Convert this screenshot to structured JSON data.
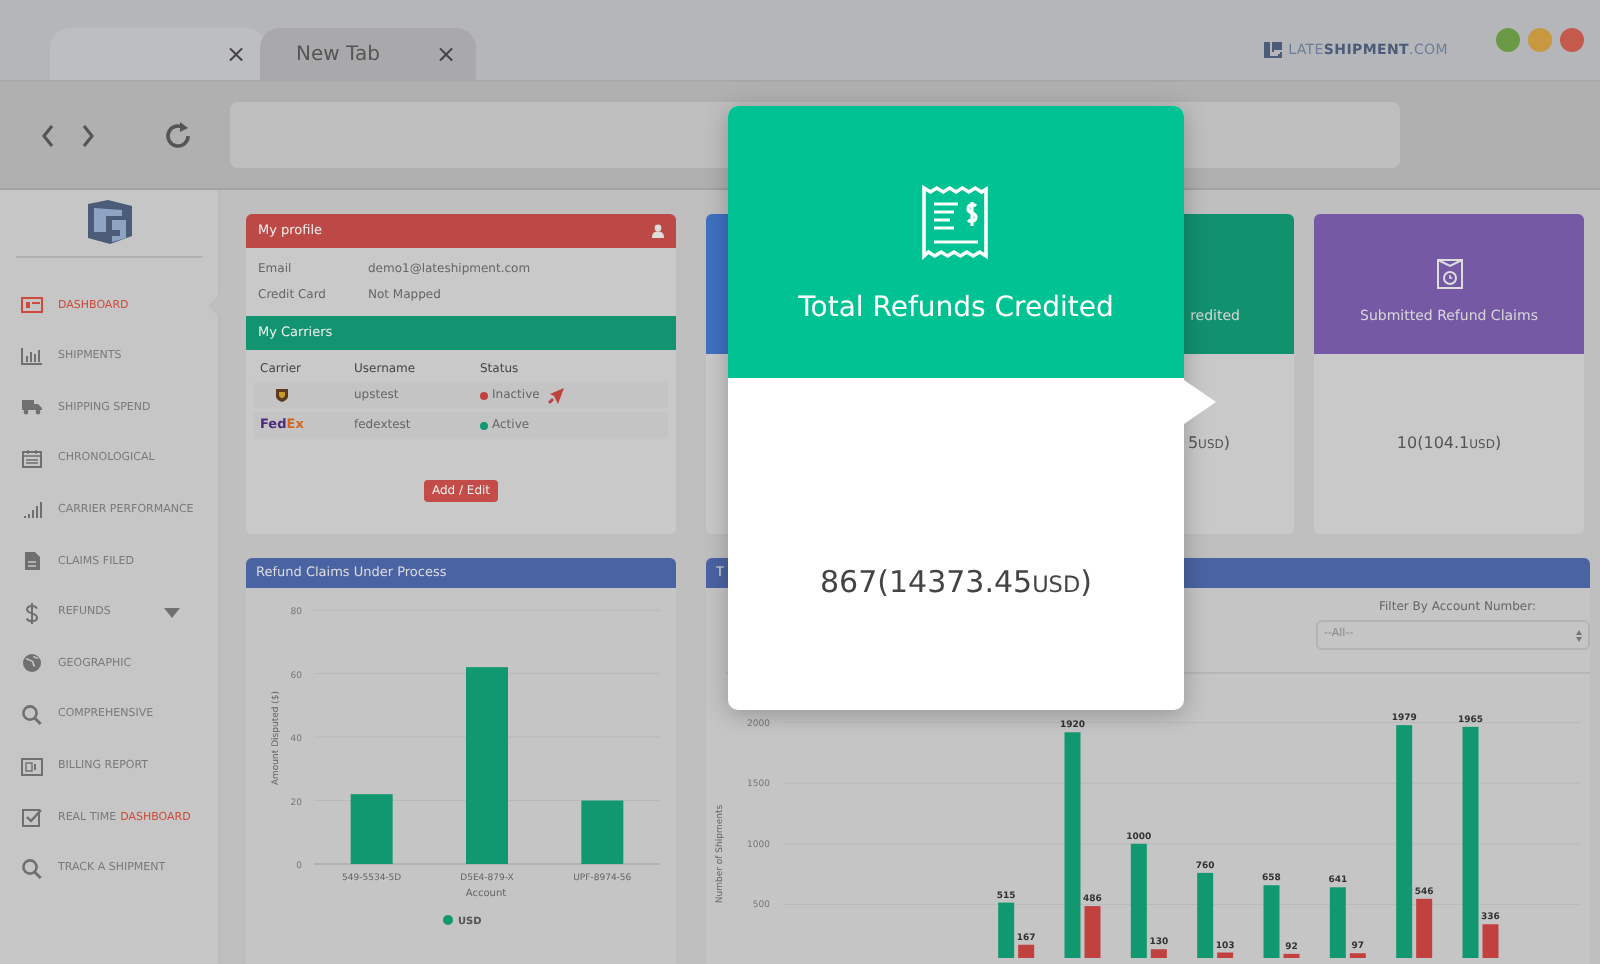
{
  "browser": {
    "tabs": [
      {
        "close": "×",
        "selected": true
      },
      {
        "label": "New Tab",
        "close": "×",
        "selected": false
      }
    ],
    "logo": {
      "parts": [
        "LATE",
        "SHIPMENT",
        ".COM"
      ]
    },
    "window_dots": [
      {
        "color": "#6a9a45"
      },
      {
        "color": "#c7983f"
      },
      {
        "color": "#c35a4c"
      }
    ]
  },
  "sidebar": {
    "items": [
      {
        "label": "DASHBOARD",
        "selected": true
      },
      {
        "label": "SHIPMENTS",
        "selected": false
      },
      {
        "label": "SHIPPING SPEND",
        "selected": false
      },
      {
        "label": "CHRONOLOGICAL",
        "selected": false
      },
      {
        "label": "CARRIER PERFORMANCE",
        "selected": false
      },
      {
        "label": "CLAIMS FILED",
        "selected": false
      },
      {
        "label": "REFUNDS",
        "selected": false,
        "dropdown": true
      },
      {
        "label": "GEOGRAPHIC",
        "selected": false
      },
      {
        "label": "COMPREHENSIVE",
        "selected": false
      },
      {
        "label": "BILLING REPORT",
        "selected": false
      },
      {
        "label": "REAL TIME",
        "accent": "DASHBOARD",
        "selected": false
      },
      {
        "label": "TRACK A SHIPMENT",
        "selected": false
      }
    ]
  },
  "profile": {
    "title": "My profile",
    "fields": [
      {
        "label": "Email",
        "value": "demo1@lateshipment.com"
      },
      {
        "label": "Credit Card",
        "value": "Not Mapped"
      }
    ]
  },
  "carriers": {
    "title": "My Carriers",
    "columns": [
      "Carrier",
      "Username",
      "Status"
    ],
    "rows": [
      {
        "kind": "ups",
        "username": "upstest",
        "status": "Inactive",
        "color": "#c0413e",
        "alert": true
      },
      {
        "kind": "fedex",
        "logo_parts": [
          "Fed",
          "Ex"
        ],
        "username": "fedextest",
        "status": "Active",
        "color": "#129871",
        "alert": false
      }
    ],
    "button": "Add / Edit"
  },
  "stat_cards": [
    {
      "kind": "blue"
    },
    {
      "kind": "green",
      "title": "redited",
      "number": "5",
      "unit": "USD",
      "suffix": ")"
    },
    {
      "kind": "purple",
      "title": "Submitted Refund Claims",
      "number": "10(104.1",
      "unit": "USD",
      "suffix": ")"
    }
  ],
  "popup": {
    "title": "Total Refunds Credited",
    "number": "867(14373.45",
    "unit": "USD",
    "suffix": ")"
  },
  "refund_claims": {
    "title": "Refund Claims Under Process",
    "chart_data": {
      "type": "bar",
      "xlabel": "Account",
      "ylabel": "Amount Disputed ($)",
      "categories": [
        "549-5534-5D",
        "D5E4-879-X",
        "UPF-8974-56"
      ],
      "series": [
        {
          "name": "USD",
          "color": "#129871",
          "values": [
            22,
            62,
            20
          ]
        }
      ],
      "ylim": [
        0,
        80
      ],
      "yticks": [
        0,
        20,
        40,
        60,
        80
      ],
      "grid": true
    }
  },
  "shipments": {
    "title": "T",
    "filter": {
      "label": "Filter By Account Number:",
      "value": "--All--"
    },
    "chart_data": {
      "type": "bar",
      "ylabel": "Number of Shipments",
      "ylim": [
        0,
        2000
      ],
      "yticks": [
        500,
        1000,
        1500,
        2000
      ],
      "grid": true,
      "stacked": false,
      "series": [
        {
          "color": "#129871",
          "values": [
            null,
            null,
            null,
            515,
            1920,
            1000,
            760,
            658,
            641,
            1979,
            1965,
            null
          ],
          "value_labels": [
            null,
            null,
            null,
            "515",
            "1920",
            "1000",
            "760",
            "658",
            "641",
            "1979",
            "1965",
            null
          ]
        },
        {
          "color": "#c0413e",
          "values": [
            null,
            null,
            null,
            167,
            486,
            130,
            103,
            92,
            97,
            546,
            336,
            null
          ],
          "value_labels": [
            null,
            null,
            null,
            "167",
            "486",
            "130",
            "103",
            "92",
            "97",
            "546",
            "336",
            null
          ]
        }
      ]
    }
  }
}
